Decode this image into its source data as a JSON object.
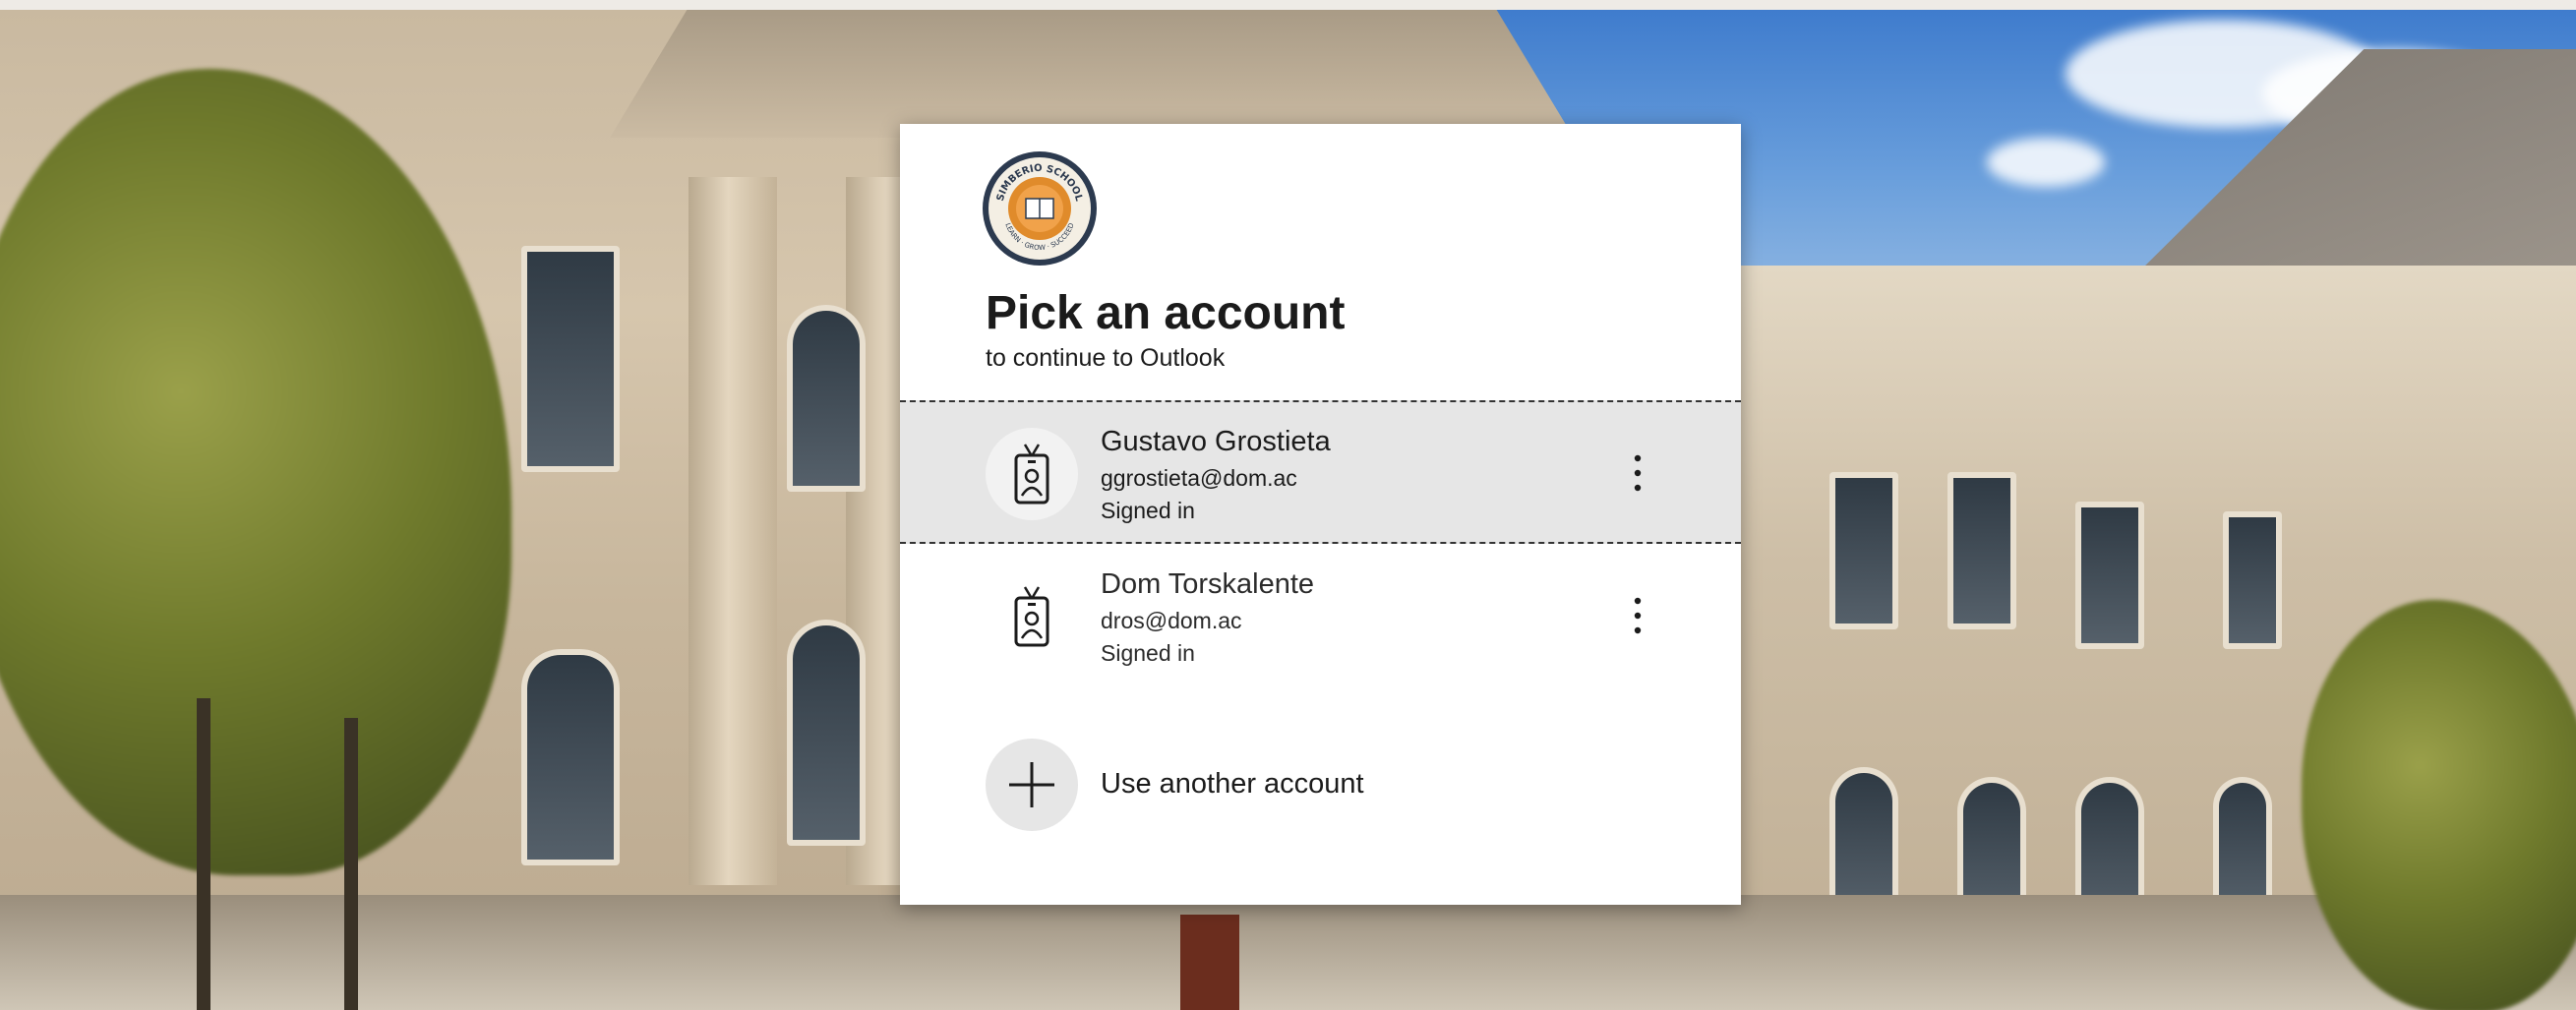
{
  "logo": {
    "icon": "school-crest-icon",
    "text_top": "SIMBERIO SCHOOL",
    "text_bottom": "LEARN · GROW · SUCCEED",
    "colors": {
      "ring": "#2c3a4f",
      "gold": "#e08b2b"
    }
  },
  "header": {
    "title": "Pick an account",
    "subtitle": "to continue to Outlook"
  },
  "accounts": [
    {
      "name": "Gustavo Grostieta",
      "email": "ggrostieta@dom.ac",
      "status": "Signed in",
      "icon": "id-badge-icon",
      "menu_icon": "more-vertical-icon"
    },
    {
      "name": "Dom Torskalente",
      "email": "dros@dom.ac",
      "status": "Signed in",
      "icon": "id-badge-icon",
      "menu_icon": "more-vertical-icon"
    }
  ],
  "use_another": {
    "label": "Use another account",
    "icon": "plus-icon"
  },
  "colors": {
    "card": "#ffffff",
    "selected_row": "#e6e6e6",
    "text": "#1b1b1b"
  }
}
